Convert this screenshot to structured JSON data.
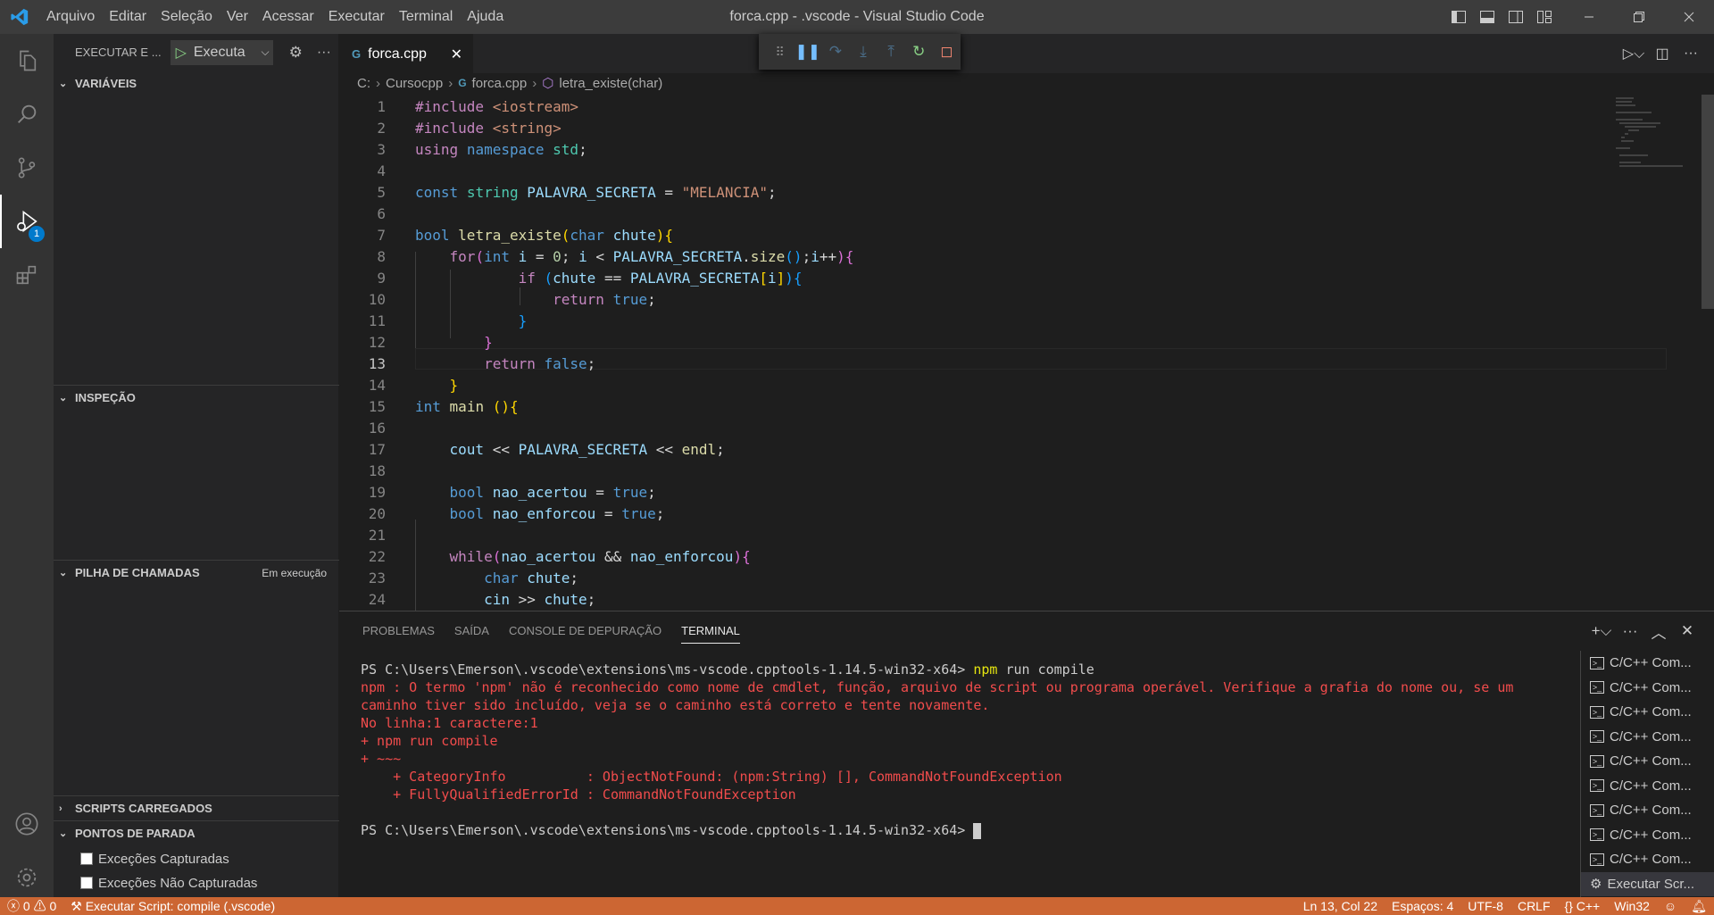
{
  "menu": [
    "Arquivo",
    "Editar",
    "Seleção",
    "Ver",
    "Acessar",
    "Executar",
    "Terminal",
    "Ajuda"
  ],
  "window_title": "forca.cpp - .vscode - Visual Studio Code",
  "activity": {
    "debug_badge": "1"
  },
  "sidebar": {
    "header": "EXECUTAR E ...",
    "run_config": "Executa",
    "variables": "VARIÁVEIS",
    "watch": "INSPEÇÃO",
    "call_stack": "PILHA DE CHAMADAS",
    "call_stack_status": "Em execução",
    "loaded_scripts": "SCRIPTS CARREGADOS",
    "breakpoints": "PONTOS DE PARADA",
    "bp_items": [
      "Exceções Capturadas",
      "Exceções Não Capturadas"
    ]
  },
  "editor": {
    "tab": "forca.cpp",
    "tab_icon": "G",
    "breadcrumb": [
      "C:",
      "Cursocpp",
      "forca.cpp",
      "letra_existe(char)"
    ],
    "current_line": 13
  },
  "panel": {
    "tabs": [
      "PROBLEMAS",
      "SAÍDA",
      "CONSOLE DE DEPURAÇÃO",
      "TERMINAL"
    ],
    "terminal_lines": [
      {
        "c": "tn",
        "t": "PS C:\\Users\\Emerson\\.vscode\\extensions\\ms-vscode.cpptools-1.14.5-win32-x64> ",
        "cmd": "npm",
        "rest": " run compile"
      },
      {
        "c": "te",
        "t": "npm : O termo 'npm' não é reconhecido como nome de cmdlet, função, arquivo de script ou programa operável. Verifique a grafia do nome ou, se um"
      },
      {
        "c": "te",
        "t": "caminho tiver sido incluído, veja se o caminho está correto e tente novamente."
      },
      {
        "c": "te",
        "t": "No linha:1 caractere:1"
      },
      {
        "c": "te",
        "t": "+ npm run compile"
      },
      {
        "c": "te",
        "t": "+ ~~~"
      },
      {
        "c": "te",
        "t": "    + CategoryInfo          : ObjectNotFound: (npm:String) [], CommandNotFoundException"
      },
      {
        "c": "te",
        "t": "    + FullyQualifiedErrorId : CommandNotFoundException"
      },
      {
        "c": "tn",
        "t": ""
      },
      {
        "c": "tn",
        "t": "PS C:\\Users\\Emerson\\.vscode\\extensions\\ms-vscode.cpptools-1.14.5-win32-x64> "
      }
    ],
    "terminal_list": [
      "C/C++ Com...",
      "C/C++ Com...",
      "C/C++ Com...",
      "C/C++ Com...",
      "C/C++ Com...",
      "C/C++ Com...",
      "C/C++ Com...",
      "C/C++ Com...",
      "C/C++ Com...",
      "Executar Scr..."
    ]
  },
  "status": {
    "errors": "0",
    "warnings": "0",
    "task": "Executar Script: compile (.vscode)",
    "position": "Ln 13, Col 22",
    "spaces": "Espaços: 4",
    "encoding": "UTF-8",
    "eol": "CRLF",
    "language": "C++",
    "platform": "Win32"
  },
  "colors": {
    "statusbar": "#cc6633",
    "accent": "#007acc"
  }
}
